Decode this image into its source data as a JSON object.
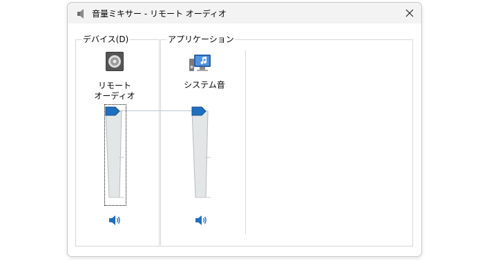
{
  "window": {
    "title": "音量ミキサー - リモート オーディオ",
    "title_icon": "speaker-icon",
    "close_icon": "close-icon"
  },
  "device_group": {
    "label": "デバイス(D)",
    "device_icon": "remote-audio-speaker-icon",
    "device_name_line1": "リモート",
    "device_name_line2": "オーディオ",
    "volume_percent": 100,
    "mute_icon": "speaker-volume-icon"
  },
  "applications_group": {
    "label": "アプリケーション",
    "app_icon": "system-sounds-icon",
    "app_name": "システム音",
    "volume_percent": 100,
    "mute_icon": "speaker-volume-icon"
  },
  "colors": {
    "thumb": "#1f6fbf",
    "track": "#dfe3e3",
    "border": "#d6d6d6"
  }
}
